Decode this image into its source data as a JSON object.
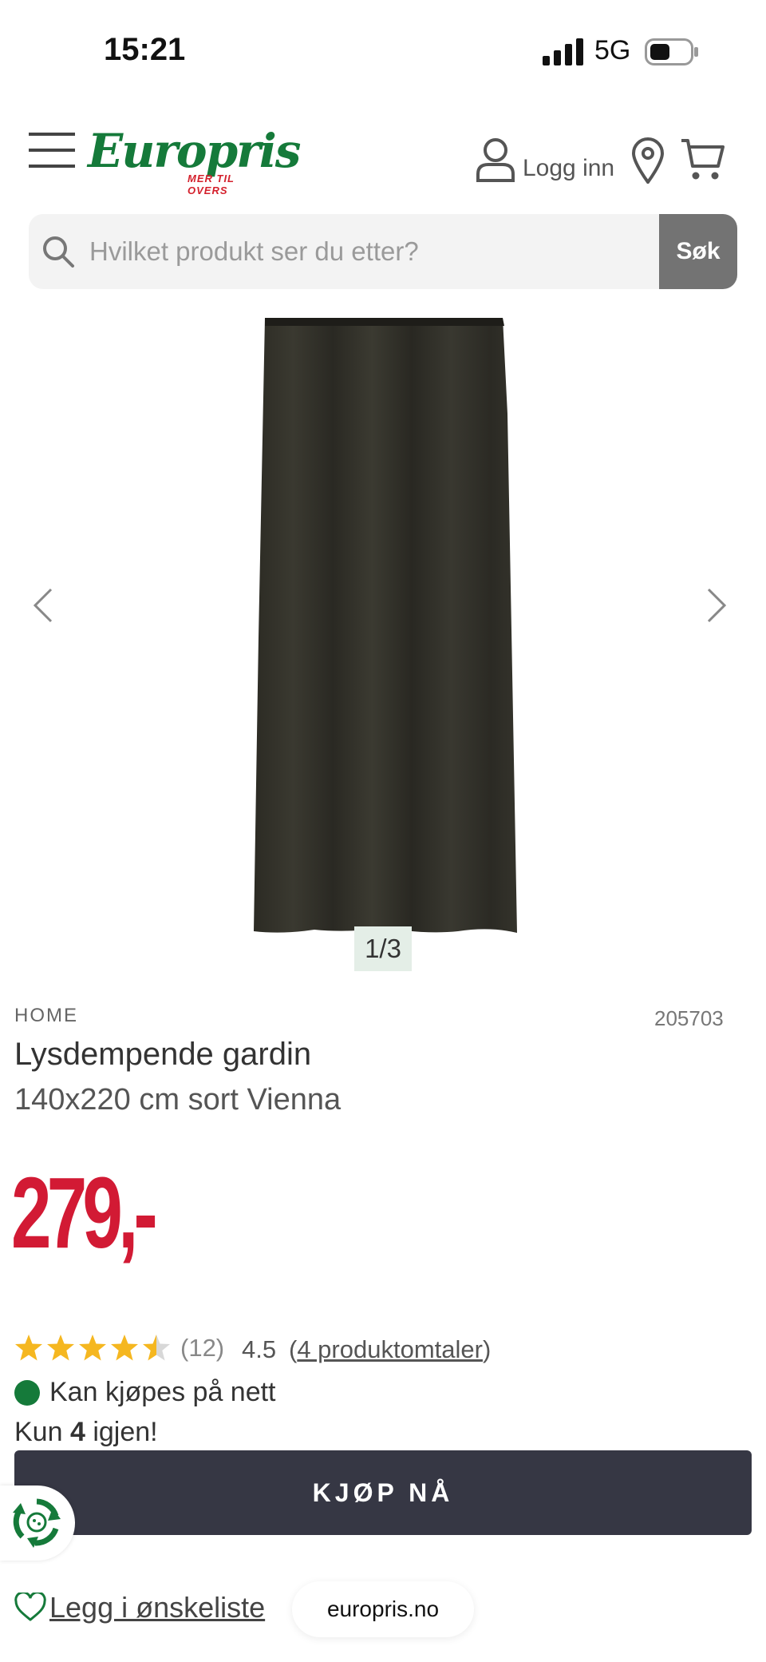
{
  "status_bar": {
    "time": "15:21",
    "network": "5G"
  },
  "header": {
    "logo_text": "Europris",
    "logo_tagline": "MER TIL OVERS",
    "login_label": "Logg inn"
  },
  "search": {
    "placeholder": "Hvilket produkt ser du etter?",
    "button_label": "Søk"
  },
  "gallery": {
    "counter": "1/3"
  },
  "product": {
    "brand": "HOME",
    "sku": "205703",
    "title": "Lysdempende gardin",
    "subtitle": "140x220 cm sort Vienna",
    "price": "279,-",
    "rating": {
      "stars": 4.5,
      "count": "(12)",
      "value": "4.5",
      "reviews_link": "4 produktomtaler"
    },
    "availability": "Kan kjøpes på nett",
    "stock": {
      "prefix": "Kun ",
      "count": "4",
      "suffix": " igjen!"
    },
    "buy_label": "KJØP NÅ",
    "wishlist_label": "Legg i ønskeliste"
  },
  "browser": {
    "url": "europris.no"
  },
  "colors": {
    "brand_green": "#157a3a",
    "price_red": "#d21a34",
    "buy_button": "#363744",
    "star": "#f5b720"
  }
}
